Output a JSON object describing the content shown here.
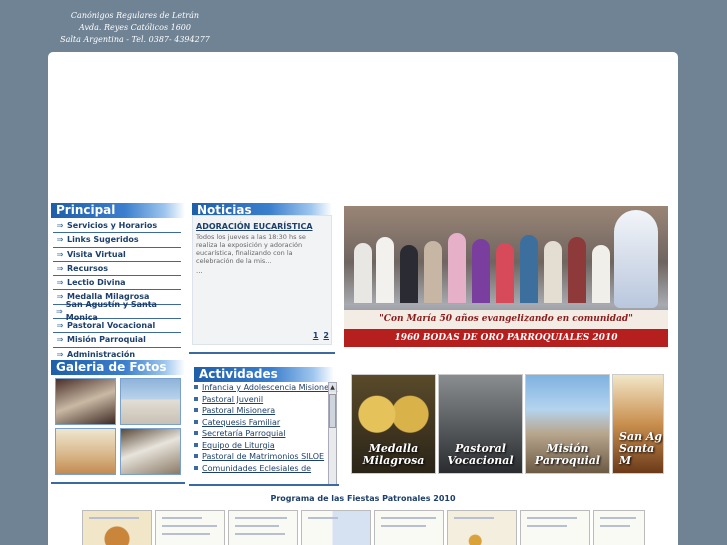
{
  "header": {
    "line1": "Canónigos Regulares de Letrán",
    "line2": "Avda. Reyes Católicos 1600",
    "line3": "Salta Argentina - Tel. 0387- 4394277"
  },
  "principal": {
    "title": "Principal",
    "items": [
      "Servicios y Horarios",
      "Links Sugeridos",
      "Visita Virtual",
      "Recursos",
      "Lectio Divina",
      "Medalla Milagrosa",
      "San Agustín y Santa Monica",
      "Pastoral Vocacional",
      "Misión Parroquial",
      "Administración"
    ]
  },
  "gallery": {
    "title": "Galeria de Fotos"
  },
  "news": {
    "title": "Noticias",
    "item_title": "ADORACIÓN EUCARÍSTICA",
    "item_body": "Todos los jueves a las 18:30 hs se realiza la exposición y adoración eucarística, finalizando con la celebración de la mis...",
    "ellipsis": "...",
    "pages": [
      "1",
      "2"
    ]
  },
  "activities": {
    "title": "Actividades",
    "items": [
      "Infancia y Adolescencia Misionera",
      "Pastoral Juvenil",
      "Pastoral Misionera",
      "Catequesis Familiar",
      "Secretaría Parroquial",
      "Equipo de Liturgia",
      "Pastoral de Matrimonios SILOE",
      "Comunidades Eclesiales de"
    ]
  },
  "banner": {
    "line1": "\"Con María 50 años evangelizando en comunidad\"",
    "line2": "1960 BODAS DE ORO PARROQUIALES 2010"
  },
  "tiles": [
    {
      "label_1": "Medalla",
      "label_2": "Milagrosa"
    },
    {
      "label_1": "Pastoral",
      "label_2": "Vocacional"
    },
    {
      "label_1": "Misión",
      "label_2": "Parroquial"
    },
    {
      "label_1": "San Ag",
      "label_2": "Santa M"
    }
  ],
  "program": {
    "title": "Programa de las Fiestas Patronales 2010"
  },
  "colors": {
    "background": "#6f8395",
    "accent": "#1f5fa8",
    "banner_red": "#b5201f"
  }
}
